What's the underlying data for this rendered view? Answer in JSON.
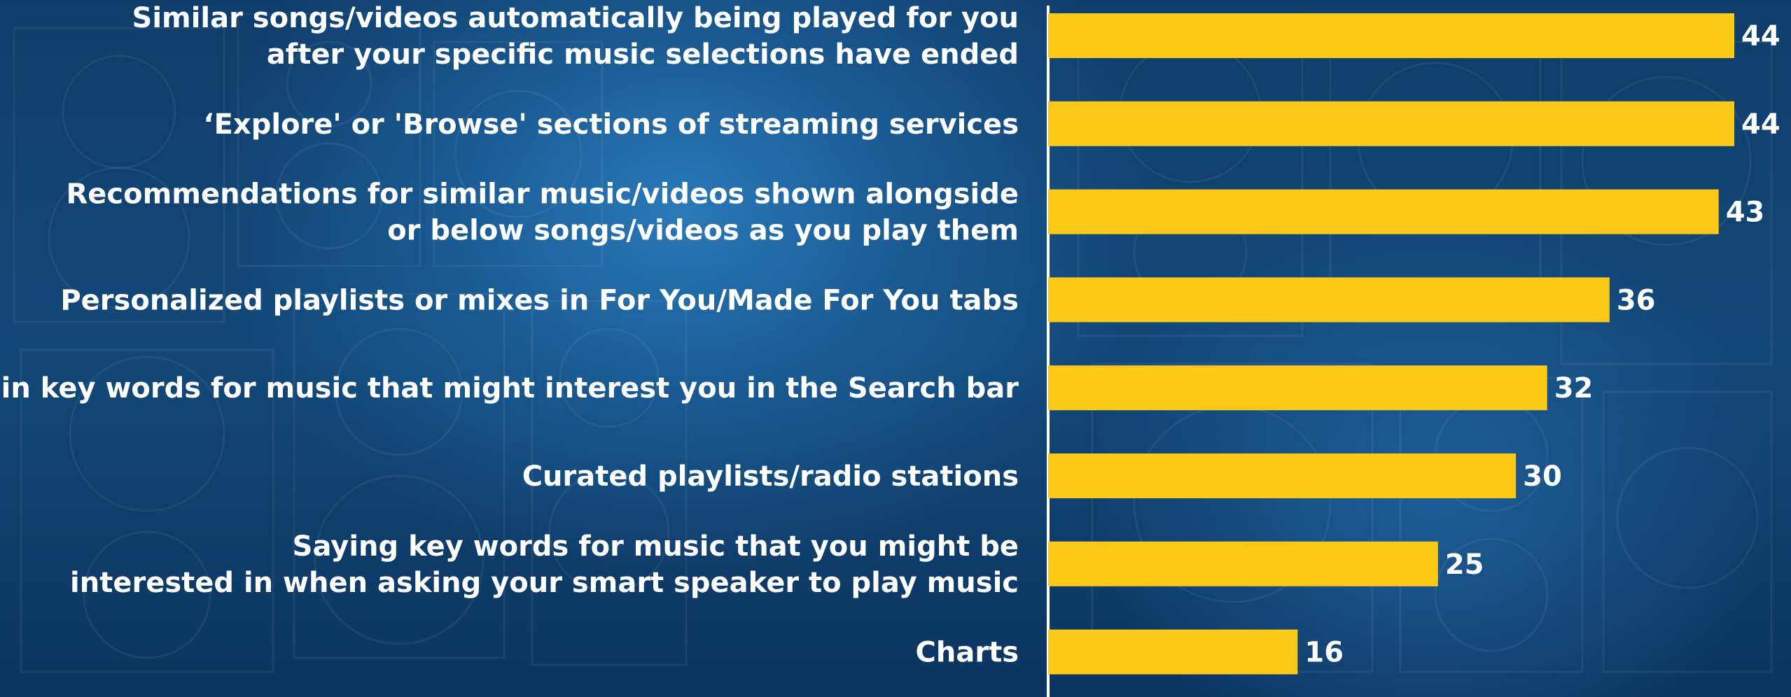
{
  "chart_data": {
    "type": "bar",
    "orientation": "horizontal",
    "title": "",
    "xlabel": "",
    "ylabel": "",
    "categories": [
      [
        "Similar songs/videos automatically being played for you",
        "after your specific music selections have ended"
      ],
      [
        "‘Explore' or 'Browse' sections of streaming services"
      ],
      [
        "Recommendations for similar music/videos shown alongside",
        "or below songs/videos as you play them"
      ],
      [
        "Personalized playlists or mixes in For You/Made For You tabs"
      ],
      [
        "Typing in key words for music that might interest you in the Search bar"
      ],
      [
        "Curated playlists/radio stations"
      ],
      [
        "Saying key words for music that you might be",
        "interested in when asking your smart speaker to play music"
      ],
      [
        "Charts"
      ]
    ],
    "values": [
      44,
      44,
      43,
      36,
      32,
      30,
      25,
      16
    ],
    "xlim": [
      0,
      44
    ],
    "grid": false,
    "legend": "none",
    "colors": {
      "bar": "#fbc918",
      "text": "#ffffff",
      "axis": "#ffffff",
      "background": "#124878"
    }
  }
}
